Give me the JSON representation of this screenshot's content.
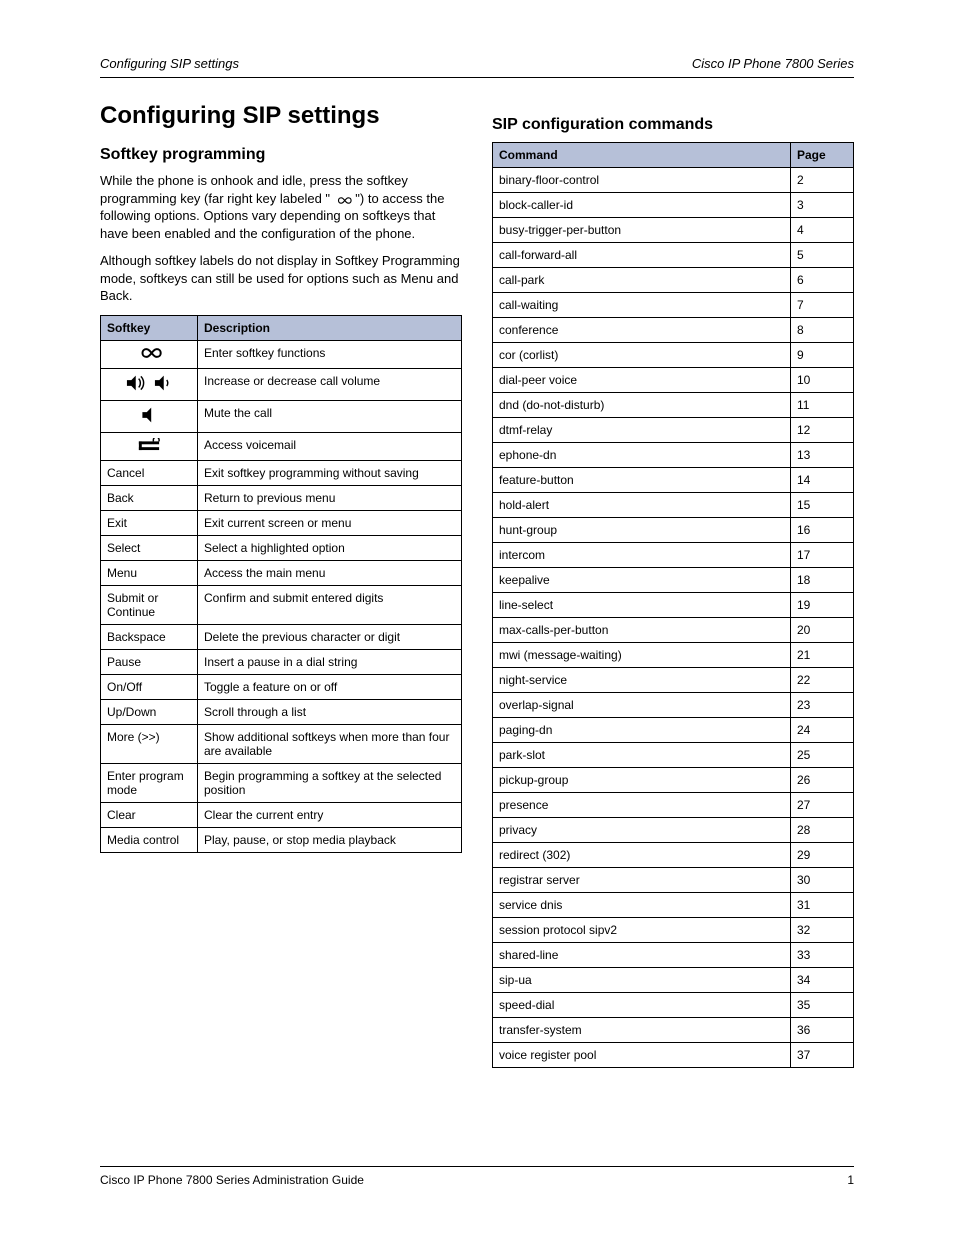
{
  "header": {
    "left": "Configuring SIP settings",
    "right": "Cisco IP Phone 7800 Series"
  },
  "title": "Configuring SIP settings",
  "section1": {
    "heading": "Softkey programming",
    "para1_a": "While the phone is onhook and idle, press the softkey programming key (far right key labeled \"",
    "para1_b": "\") to access the following options. Options vary depending on softkeys that have been enabled and the configuration of the phone.",
    "para2": "Although softkey labels do not display in Softkey Programming mode, softkeys can still be used for options such as Menu and Back."
  },
  "table1": {
    "headers": [
      "Softkey",
      "Description"
    ],
    "rows": [
      {
        "icon": "infinity",
        "desc": "Enter softkey functions"
      },
      {
        "icon": "volume-pair",
        "desc": "Increase or decrease call volume"
      },
      {
        "icon": "mute",
        "desc": "Mute the call"
      },
      {
        "icon": "voicemail",
        "desc": "Access voicemail"
      },
      {
        "label": "Cancel",
        "desc": "Exit softkey programming without saving"
      },
      {
        "label": "Back",
        "desc": "Return to previous menu"
      },
      {
        "label": "Exit",
        "desc": "Exit current screen or menu"
      },
      {
        "label": "Select",
        "desc": "Select a highlighted option"
      },
      {
        "label": "Menu",
        "desc": "Access the main menu"
      },
      {
        "label": "Submit or Continue",
        "desc": "Confirm and submit entered digits"
      },
      {
        "label": "Backspace",
        "desc": "Delete the previous character or digit"
      },
      {
        "label": "Pause",
        "desc": "Insert a pause in a dial string"
      },
      {
        "label": "On/Off",
        "desc": "Toggle a feature on or off"
      },
      {
        "label": "Up/Down",
        "desc": "Scroll through a list"
      },
      {
        "label": "More (>>)",
        "desc": "Show additional softkeys when more than four are available"
      },
      {
        "label": "Enter program mode",
        "desc": "Begin programming a softkey at the selected position"
      },
      {
        "label": "Clear",
        "desc": "Clear the current entry"
      },
      {
        "label": "Media control",
        "desc": "Play, pause, or stop media playback"
      }
    ]
  },
  "section2": {
    "heading": "SIP configuration commands"
  },
  "table2": {
    "headers": [
      "Command",
      "Page"
    ],
    "rows": [
      [
        "binary-floor-control",
        "2"
      ],
      [
        "block-caller-id",
        "3"
      ],
      [
        "busy-trigger-per-button",
        "4"
      ],
      [
        "call-forward-all",
        "5"
      ],
      [
        "call-park",
        "6"
      ],
      [
        "call-waiting",
        "7"
      ],
      [
        "conference",
        "8"
      ],
      [
        "cor (corlist)",
        "9"
      ],
      [
        "dial-peer voice",
        "10"
      ],
      [
        "dnd (do-not-disturb)",
        "11"
      ],
      [
        "dtmf-relay",
        "12"
      ],
      [
        "ephone-dn",
        "13"
      ],
      [
        "feature-button",
        "14"
      ],
      [
        "hold-alert",
        "15"
      ],
      [
        "hunt-group",
        "16"
      ],
      [
        "intercom",
        "17"
      ],
      [
        "keepalive",
        "18"
      ],
      [
        "line-select",
        "19"
      ],
      [
        "max-calls-per-button",
        "20"
      ],
      [
        "mwi (message-waiting)",
        "21"
      ],
      [
        "night-service",
        "22"
      ],
      [
        "overlap-signal",
        "23"
      ],
      [
        "paging-dn",
        "24"
      ],
      [
        "park-slot",
        "25"
      ],
      [
        "pickup-group",
        "26"
      ],
      [
        "presence",
        "27"
      ],
      [
        "privacy",
        "28"
      ],
      [
        "redirect (302)",
        "29"
      ],
      [
        "registrar server",
        "30"
      ],
      [
        "service dnis",
        "31"
      ],
      [
        "session protocol sipv2",
        "32"
      ],
      [
        "shared-line",
        "33"
      ],
      [
        "sip-ua",
        "34"
      ],
      [
        "speed-dial",
        "35"
      ],
      [
        "transfer-system",
        "36"
      ],
      [
        "voice register pool",
        "37"
      ]
    ]
  },
  "footer": {
    "left": "Cisco IP Phone 7800 Series Administration Guide",
    "right": "1"
  }
}
